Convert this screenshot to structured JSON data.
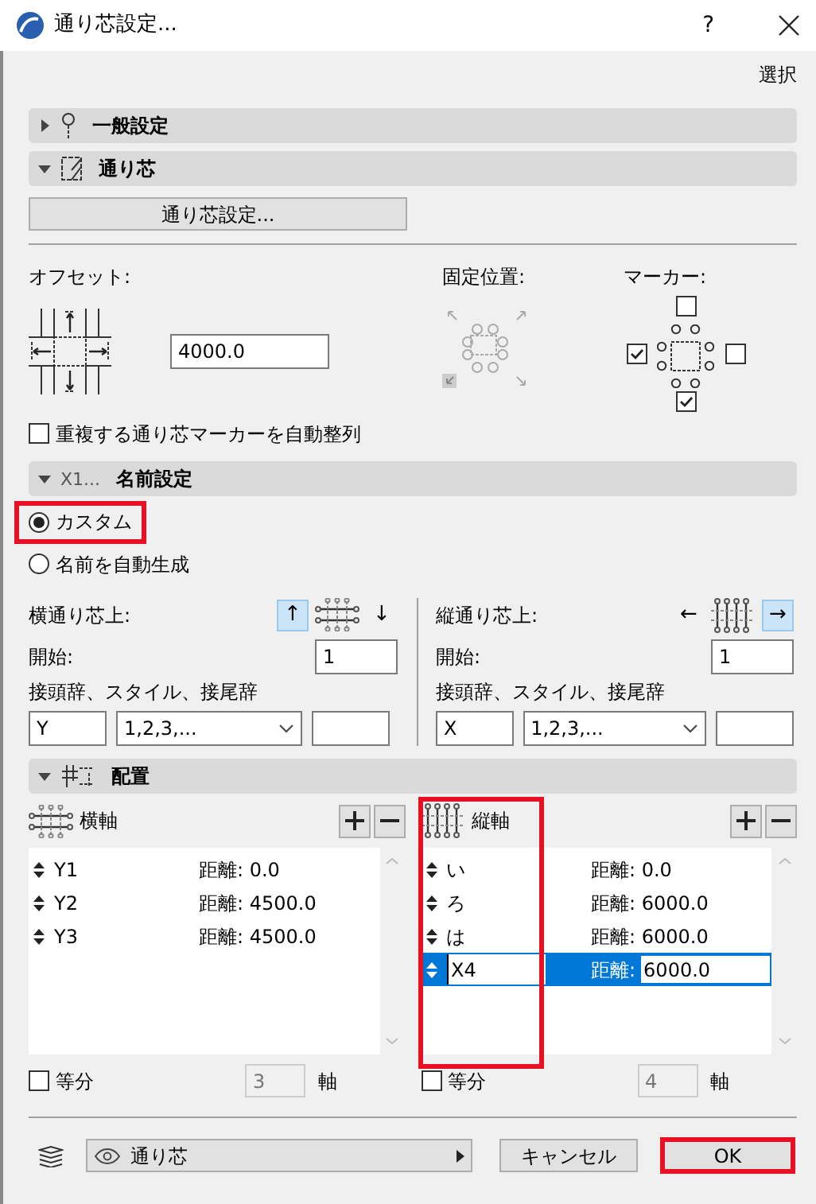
{
  "window": {
    "title": "通り芯設定...",
    "help": "?"
  },
  "select_link": "選択",
  "general_panel": {
    "title": "一般設定",
    "expanded": false
  },
  "grid_panel": {
    "title": "通り芯",
    "expanded": true,
    "button": "通り芯設定..."
  },
  "offset": {
    "label": "オフセット:",
    "value": "4000.0"
  },
  "anchor": {
    "label": "固定位置:"
  },
  "markers": {
    "label": "マーカー:",
    "top": false,
    "left": true,
    "right": false,
    "bottom": true
  },
  "auto_arrange": {
    "label": "重複する通り芯マーカーを自動整列",
    "checked": false
  },
  "naming_panel": {
    "title": "名前設定",
    "icon_label": "X1...",
    "expanded": true
  },
  "naming_options": [
    {
      "label": "カスタム",
      "selected": true,
      "highlighted": true
    },
    {
      "label": "名前を自動生成",
      "selected": false,
      "highlighted": false
    }
  ],
  "naming": [
    {
      "label": "横通り芯上:",
      "arrows": [
        {
          "symbol": "↑",
          "selected": true
        },
        {
          "symbol": "↓",
          "selected": false
        }
      ],
      "start_label": "開始:",
      "start": "1",
      "format_label": "接頭辞、スタイル、接尾辞",
      "prefix": "Y",
      "style": "1,2,3,..."
    },
    {
      "label": "縦通り芯上:",
      "arrows": [
        {
          "symbol": "←",
          "selected": false
        },
        {
          "symbol": "→",
          "selected": true
        }
      ],
      "start_label": "開始:",
      "start": "1",
      "format_label": "接頭辞、スタイル、接尾辞",
      "prefix": "X",
      "style": "1,2,3,..."
    }
  ],
  "layout_panel": {
    "title": "配置",
    "expanded": true
  },
  "axes": [
    {
      "title": "横軸",
      "highlighted": false,
      "rows": [
        {
          "name": "Y1",
          "distance_label": "距離:",
          "distance": "0.0",
          "selected": false
        },
        {
          "name": "Y2",
          "distance_label": "距離:",
          "distance": "4500.0",
          "selected": false
        },
        {
          "name": "Y3",
          "distance_label": "距離:",
          "distance": "4500.0",
          "selected": false
        }
      ],
      "equal_label": "等分",
      "equal": false,
      "count": "3",
      "count_disabled": true,
      "unit": "軸"
    },
    {
      "title": "縦軸",
      "highlighted": true,
      "rows": [
        {
          "name": "い",
          "distance_label": "距離:",
          "distance": "0.0",
          "selected": false
        },
        {
          "name": "ろ",
          "distance_label": "距離:",
          "distance": "6000.0",
          "selected": false
        },
        {
          "name": "は",
          "distance_label": "距離:",
          "distance": "6000.0",
          "selected": false
        },
        {
          "name": "X4",
          "distance_label": "距離:",
          "distance": "6000.0",
          "selected": true
        }
      ],
      "equal_label": "等分",
      "equal": false,
      "count": "4",
      "count_disabled": true,
      "unit": "軸"
    }
  ],
  "layer": {
    "name": "通り芯"
  },
  "buttons": [
    {
      "label": "キャンセル",
      "highlighted": false
    },
    {
      "label": "OK",
      "highlighted": true
    }
  ]
}
